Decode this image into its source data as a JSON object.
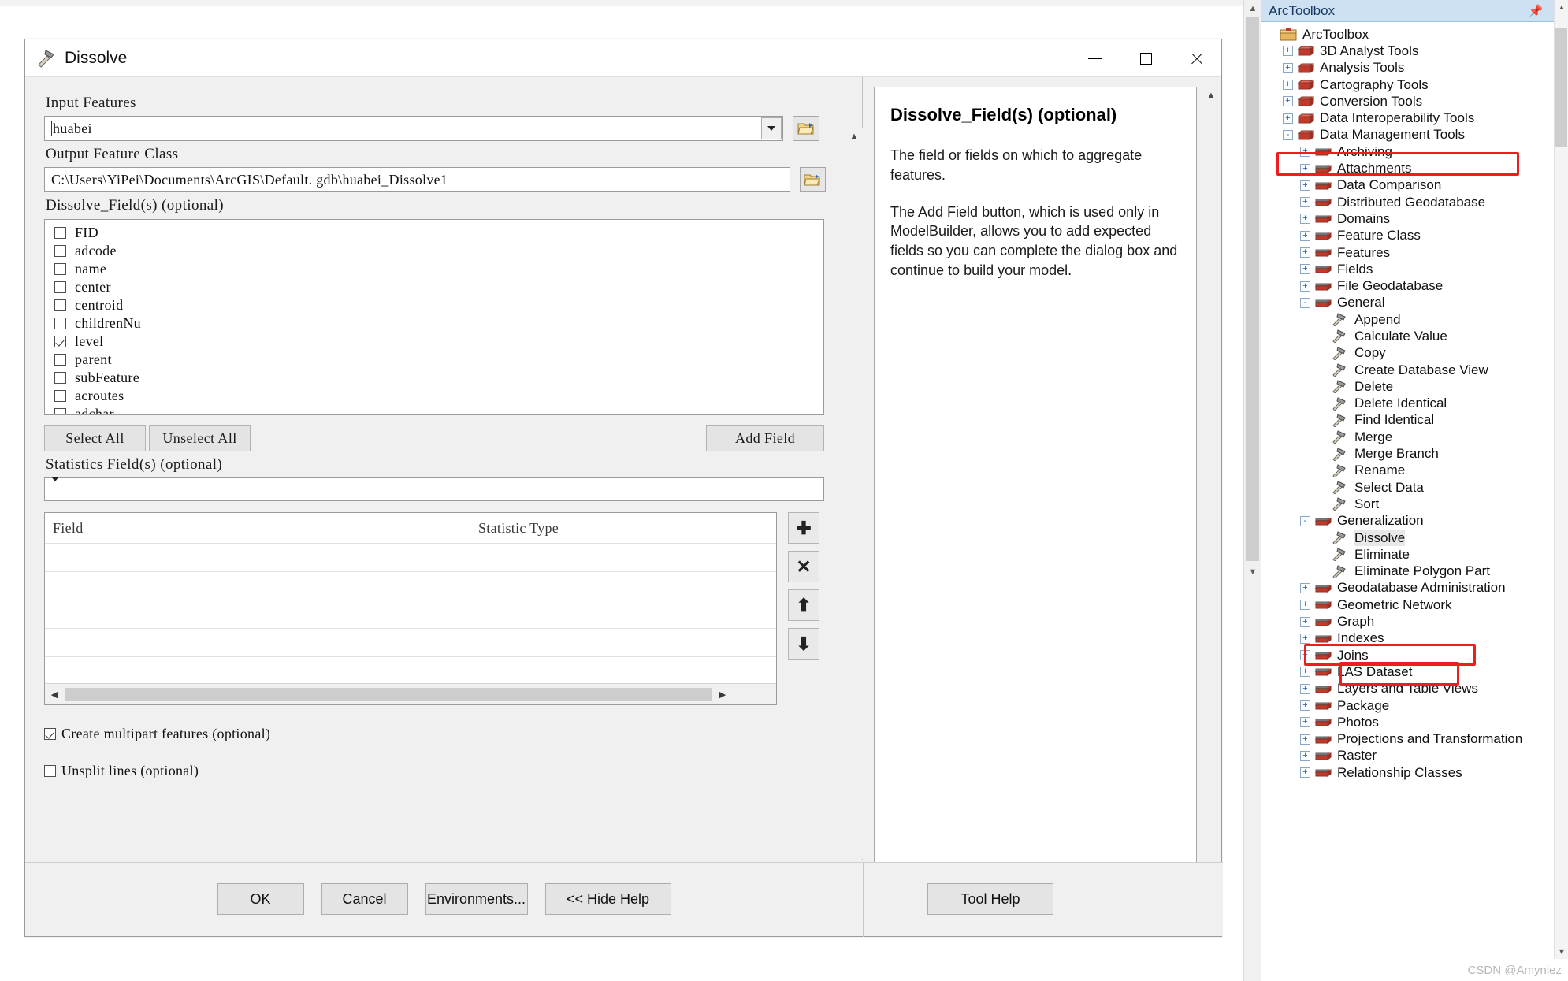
{
  "dialog": {
    "title": "Dissolve",
    "title_icon": "hammer-tool-icon",
    "window_buttons": {
      "minimize": "minimize-icon",
      "maximize": "maximize-icon",
      "close": "close-icon"
    },
    "labels": {
      "input_features": "Input Features",
      "output_feature_class": "Output Feature Class",
      "dissolve_fields": "Dissolve_Field(s)  (optional)",
      "statistics_fields": "Statistics Field(s)  (optional)"
    },
    "input_features_value": "huabei",
    "output_feature_class_value": "C:\\Users\\YiPei\\Documents\\ArcGIS\\Default. gdb\\huabei_Dissolve1",
    "statistics_fields_value": "",
    "browse_icon": "folder-open-icon",
    "dropdown_icon": "chevron-down-icon",
    "fields": [
      {
        "name": "FID",
        "checked": false
      },
      {
        "name": "adcode",
        "checked": false
      },
      {
        "name": "name",
        "checked": false
      },
      {
        "name": "center",
        "checked": false
      },
      {
        "name": "centroid",
        "checked": false
      },
      {
        "name": "childrenNu",
        "checked": false
      },
      {
        "name": "level",
        "checked": true
      },
      {
        "name": "parent",
        "checked": false
      },
      {
        "name": "subFeature",
        "checked": false
      },
      {
        "name": "acroutes",
        "checked": false
      },
      {
        "name": "adchar",
        "checked": false
      }
    ],
    "buttons": {
      "select_all": "Select All",
      "unselect_all": "Unselect All",
      "add_field": "Add Field"
    },
    "grid": {
      "columns": [
        "Field",
        "Statistic Type"
      ],
      "rows": [],
      "empty_row_count": 5,
      "side_buttons": [
        {
          "name": "add-row-button",
          "glyph": "plus-icon"
        },
        {
          "name": "delete-row-button",
          "glyph": "x-icon"
        },
        {
          "name": "move-up-button",
          "glyph": "arrow-up-icon"
        },
        {
          "name": "move-down-button",
          "glyph": "arrow-down-icon"
        }
      ]
    },
    "options": [
      {
        "label": "Create multipart features  (optional)",
        "checked": true
      },
      {
        "label": "Unsplit lines  (optional)",
        "checked": false
      }
    ],
    "footer_buttons": {
      "ok": "OK",
      "cancel": "Cancel",
      "environments": "Environments...",
      "hide_help": "<< Hide Help",
      "tool_help": "Tool Help"
    }
  },
  "help": {
    "title": "Dissolve_Field(s) (optional)",
    "paragraph1": "The field or fields on which to aggregate features.",
    "paragraph2": "The Add Field button, which is used only in ModelBuilder, allows you to add expected fields so you can complete the dialog box and continue to build your model."
  },
  "toolbox": {
    "panel_title": "ArcToolbox",
    "pin_icon": "pin-icon",
    "close_icon": "close-icon",
    "tree": [
      {
        "label": "ArcToolbox",
        "indent": 0,
        "expander": "none",
        "icon": "toolbox-root-icon",
        "selected": false
      },
      {
        "label": "3D Analyst Tools",
        "indent": 1,
        "expander": "+",
        "icon": "toolbox-icon",
        "selected": false
      },
      {
        "label": "Analysis Tools",
        "indent": 1,
        "expander": "+",
        "icon": "toolbox-icon",
        "selected": false
      },
      {
        "label": "Cartography Tools",
        "indent": 1,
        "expander": "+",
        "icon": "toolbox-icon",
        "selected": false
      },
      {
        "label": "Conversion Tools",
        "indent": 1,
        "expander": "+",
        "icon": "toolbox-icon",
        "selected": false
      },
      {
        "label": "Data Interoperability Tools",
        "indent": 1,
        "expander": "+",
        "icon": "toolbox-icon",
        "selected": false
      },
      {
        "label": "Data Management Tools",
        "indent": 1,
        "expander": "-",
        "icon": "toolbox-icon",
        "selected": false
      },
      {
        "label": "Archiving",
        "indent": 2,
        "expander": "+",
        "icon": "toolset-icon",
        "selected": false
      },
      {
        "label": "Attachments",
        "indent": 2,
        "expander": "+",
        "icon": "toolset-icon",
        "selected": false
      },
      {
        "label": "Data Comparison",
        "indent": 2,
        "expander": "+",
        "icon": "toolset-icon",
        "selected": false
      },
      {
        "label": "Distributed Geodatabase",
        "indent": 2,
        "expander": "+",
        "icon": "toolset-icon",
        "selected": false
      },
      {
        "label": "Domains",
        "indent": 2,
        "expander": "+",
        "icon": "toolset-icon",
        "selected": false
      },
      {
        "label": "Feature Class",
        "indent": 2,
        "expander": "+",
        "icon": "toolset-icon",
        "selected": false
      },
      {
        "label": "Features",
        "indent": 2,
        "expander": "+",
        "icon": "toolset-icon",
        "selected": false
      },
      {
        "label": "Fields",
        "indent": 2,
        "expander": "+",
        "icon": "toolset-icon",
        "selected": false
      },
      {
        "label": "File Geodatabase",
        "indent": 2,
        "expander": "+",
        "icon": "toolset-icon",
        "selected": false
      },
      {
        "label": "General",
        "indent": 2,
        "expander": "-",
        "icon": "toolset-icon",
        "selected": false
      },
      {
        "label": "Append",
        "indent": 3,
        "expander": "none",
        "icon": "tool-icon",
        "selected": false
      },
      {
        "label": "Calculate Value",
        "indent": 3,
        "expander": "none",
        "icon": "tool-icon",
        "selected": false
      },
      {
        "label": "Copy",
        "indent": 3,
        "expander": "none",
        "icon": "tool-icon",
        "selected": false
      },
      {
        "label": "Create Database View",
        "indent": 3,
        "expander": "none",
        "icon": "tool-icon",
        "selected": false
      },
      {
        "label": "Delete",
        "indent": 3,
        "expander": "none",
        "icon": "tool-icon",
        "selected": false
      },
      {
        "label": "Delete Identical",
        "indent": 3,
        "expander": "none",
        "icon": "tool-icon",
        "selected": false
      },
      {
        "label": "Find Identical",
        "indent": 3,
        "expander": "none",
        "icon": "tool-icon",
        "selected": false
      },
      {
        "label": "Merge",
        "indent": 3,
        "expander": "none",
        "icon": "tool-icon",
        "selected": false
      },
      {
        "label": "Merge Branch",
        "indent": 3,
        "expander": "none",
        "icon": "tool-icon",
        "selected": false
      },
      {
        "label": "Rename",
        "indent": 3,
        "expander": "none",
        "icon": "tool-icon",
        "selected": false
      },
      {
        "label": "Select Data",
        "indent": 3,
        "expander": "none",
        "icon": "tool-icon",
        "selected": false
      },
      {
        "label": "Sort",
        "indent": 3,
        "expander": "none",
        "icon": "tool-icon",
        "selected": false
      },
      {
        "label": "Generalization",
        "indent": 2,
        "expander": "-",
        "icon": "toolset-icon",
        "selected": false
      },
      {
        "label": "Dissolve",
        "indent": 3,
        "expander": "none",
        "icon": "tool-icon",
        "selected": true
      },
      {
        "label": "Eliminate",
        "indent": 3,
        "expander": "none",
        "icon": "tool-icon",
        "selected": false
      },
      {
        "label": "Eliminate Polygon Part",
        "indent": 3,
        "expander": "none",
        "icon": "tool-icon",
        "selected": false
      },
      {
        "label": "Geodatabase Administration",
        "indent": 2,
        "expander": "+",
        "icon": "toolset-icon",
        "selected": false
      },
      {
        "label": "Geometric Network",
        "indent": 2,
        "expander": "+",
        "icon": "toolset-icon",
        "selected": false
      },
      {
        "label": "Graph",
        "indent": 2,
        "expander": "+",
        "icon": "toolset-icon",
        "selected": false
      },
      {
        "label": "Indexes",
        "indent": 2,
        "expander": "+",
        "icon": "toolset-icon",
        "selected": false
      },
      {
        "label": "Joins",
        "indent": 2,
        "expander": "+",
        "icon": "toolset-icon",
        "selected": false
      },
      {
        "label": "LAS Dataset",
        "indent": 2,
        "expander": "+",
        "icon": "toolset-icon",
        "selected": false
      },
      {
        "label": "Layers and Table Views",
        "indent": 2,
        "expander": "+",
        "icon": "toolset-icon",
        "selected": false
      },
      {
        "label": "Package",
        "indent": 2,
        "expander": "+",
        "icon": "toolset-icon",
        "selected": false
      },
      {
        "label": "Photos",
        "indent": 2,
        "expander": "+",
        "icon": "toolset-icon",
        "selected": false
      },
      {
        "label": "Projections and Transformation",
        "indent": 2,
        "expander": "+",
        "icon": "toolset-icon",
        "selected": false
      },
      {
        "label": "Raster",
        "indent": 2,
        "expander": "+",
        "icon": "toolset-icon",
        "selected": false
      },
      {
        "label": "Relationship Classes",
        "indent": 2,
        "expander": "+",
        "icon": "toolset-icon",
        "selected": false
      }
    ]
  },
  "annotations": {
    "highlight_color": "#ef1d1d",
    "highlighted_items": [
      "Data Management Tools",
      "Generalization",
      "Dissolve"
    ]
  },
  "watermark": "CSDN @Amyniez"
}
